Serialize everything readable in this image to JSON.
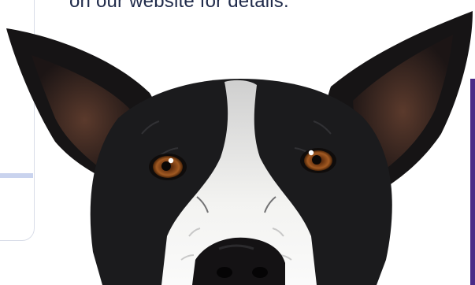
{
  "caption": {
    "text": "on our website for details."
  },
  "photo": {
    "subject": "dog-face"
  },
  "colors": {
    "caption_text": "#1f2a4a",
    "card_border": "#d9dde8",
    "card_divider": "#c9d3ee",
    "accent": "#4a2a88",
    "fur_black": "#1b1b1d",
    "fur_white": "#f2f2f0",
    "iris": "#8a4a1c"
  }
}
